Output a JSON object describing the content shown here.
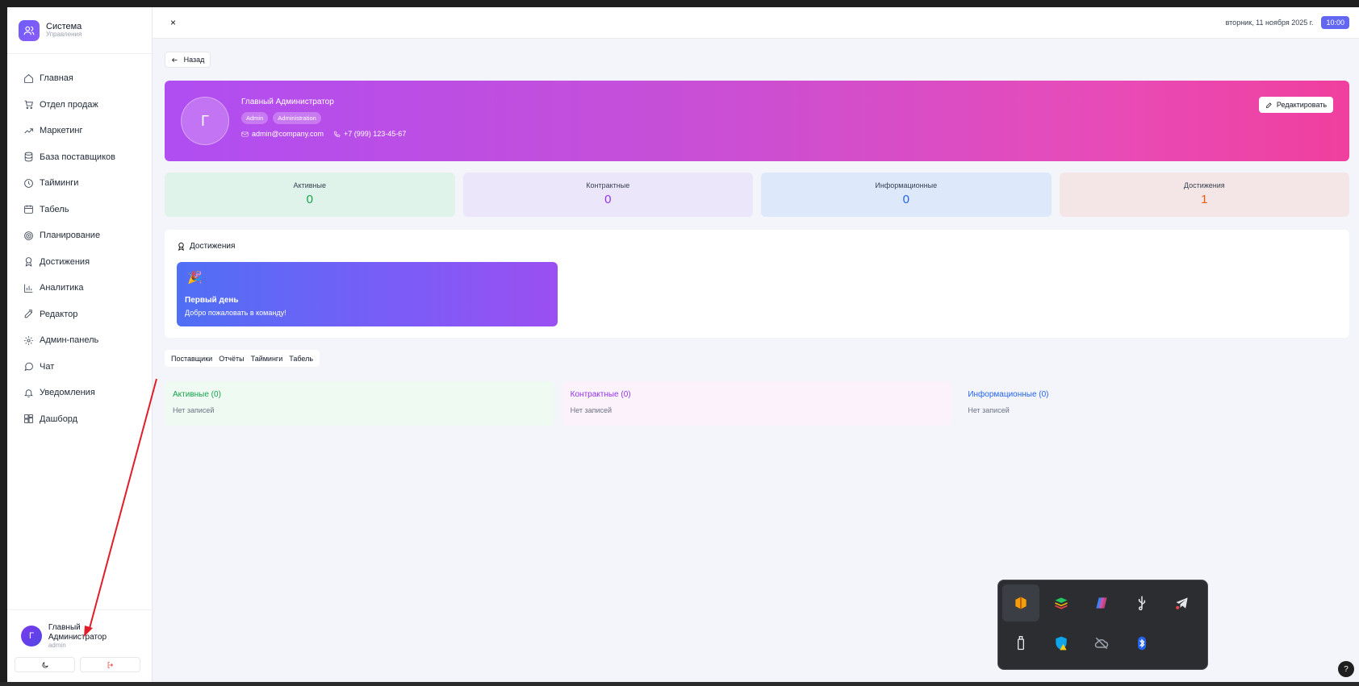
{
  "brand": {
    "title": "Система",
    "subtitle": "Управления"
  },
  "nav": [
    {
      "label": "Главная",
      "icon": "home-icon"
    },
    {
      "label": "Отдел продаж",
      "icon": "cart-icon"
    },
    {
      "label": "Маркетинг",
      "icon": "trend-icon"
    },
    {
      "label": "База поставщиков",
      "icon": "database-icon"
    },
    {
      "label": "Тайминги",
      "icon": "clock-icon"
    },
    {
      "label": "Табель",
      "icon": "calendar-icon"
    },
    {
      "label": "Планирование",
      "icon": "target-icon"
    },
    {
      "label": "Достижения",
      "icon": "award-icon"
    },
    {
      "label": "Аналитика",
      "icon": "chart-icon"
    },
    {
      "label": "Редактор",
      "icon": "edit-icon"
    },
    {
      "label": "Админ-панель",
      "icon": "gear-icon"
    },
    {
      "label": "Чат",
      "icon": "chat-icon"
    },
    {
      "label": "Уведомления",
      "icon": "bell-icon"
    },
    {
      "label": "Дашборд",
      "icon": "dashboard-icon"
    }
  ],
  "user": {
    "initial": "Г",
    "name": "Главный Администратор",
    "role": "admin"
  },
  "topbar": {
    "close": "×",
    "date": "вторник, 11 ноября 2025 г.",
    "time": "10:00"
  },
  "back": {
    "label": "Назад"
  },
  "profile": {
    "initial": "Г",
    "name": "Главный Администратор",
    "tags": [
      "Admin",
      "Administration"
    ],
    "email": "admin@company.com",
    "phone": "+7 (999) 123-45-67",
    "edit_label": "Редактировать"
  },
  "stats": [
    {
      "label": "Активные",
      "value": "0",
      "bg": "#dff3ea",
      "color": "#16a34a"
    },
    {
      "label": "Контрактные",
      "value": "0",
      "bg": "#ece6fb",
      "color": "#9333ea"
    },
    {
      "label": "Информационные",
      "value": "0",
      "bg": "#dde8fb",
      "color": "#2563eb"
    },
    {
      "label": "Достижения",
      "value": "1",
      "bg": "#f4e6e6",
      "color": "#ea580c"
    }
  ],
  "achievements": {
    "title": "Достижения",
    "card": {
      "emoji": "🎉",
      "name": "Первый день",
      "desc": "Добро пожаловать в команду!"
    }
  },
  "tabs": [
    "Поставщики",
    "Отчёты",
    "Тайминги",
    "Табель"
  ],
  "groups": [
    {
      "title": "Активные (0)",
      "empty": "Нет записей",
      "bg": "#effaf3",
      "color": "#16a34a"
    },
    {
      "title": "Контрактные (0)",
      "empty": "Нет записей",
      "bg": "#fbf2fb",
      "color": "#9333ea"
    },
    {
      "title": "Информационные (0)",
      "empty": "Нет записей",
      "bg": "#f3f5fb",
      "color": "#2563eb"
    }
  ],
  "tray": [
    "orange-app-icon",
    "bluestacks-icon",
    "copilot-icon",
    "usb-icon",
    "telegram-icon",
    "usb-drive-icon",
    "defender-warning-icon",
    "cloud-off-icon",
    "bluetooth-icon"
  ],
  "help": "?"
}
